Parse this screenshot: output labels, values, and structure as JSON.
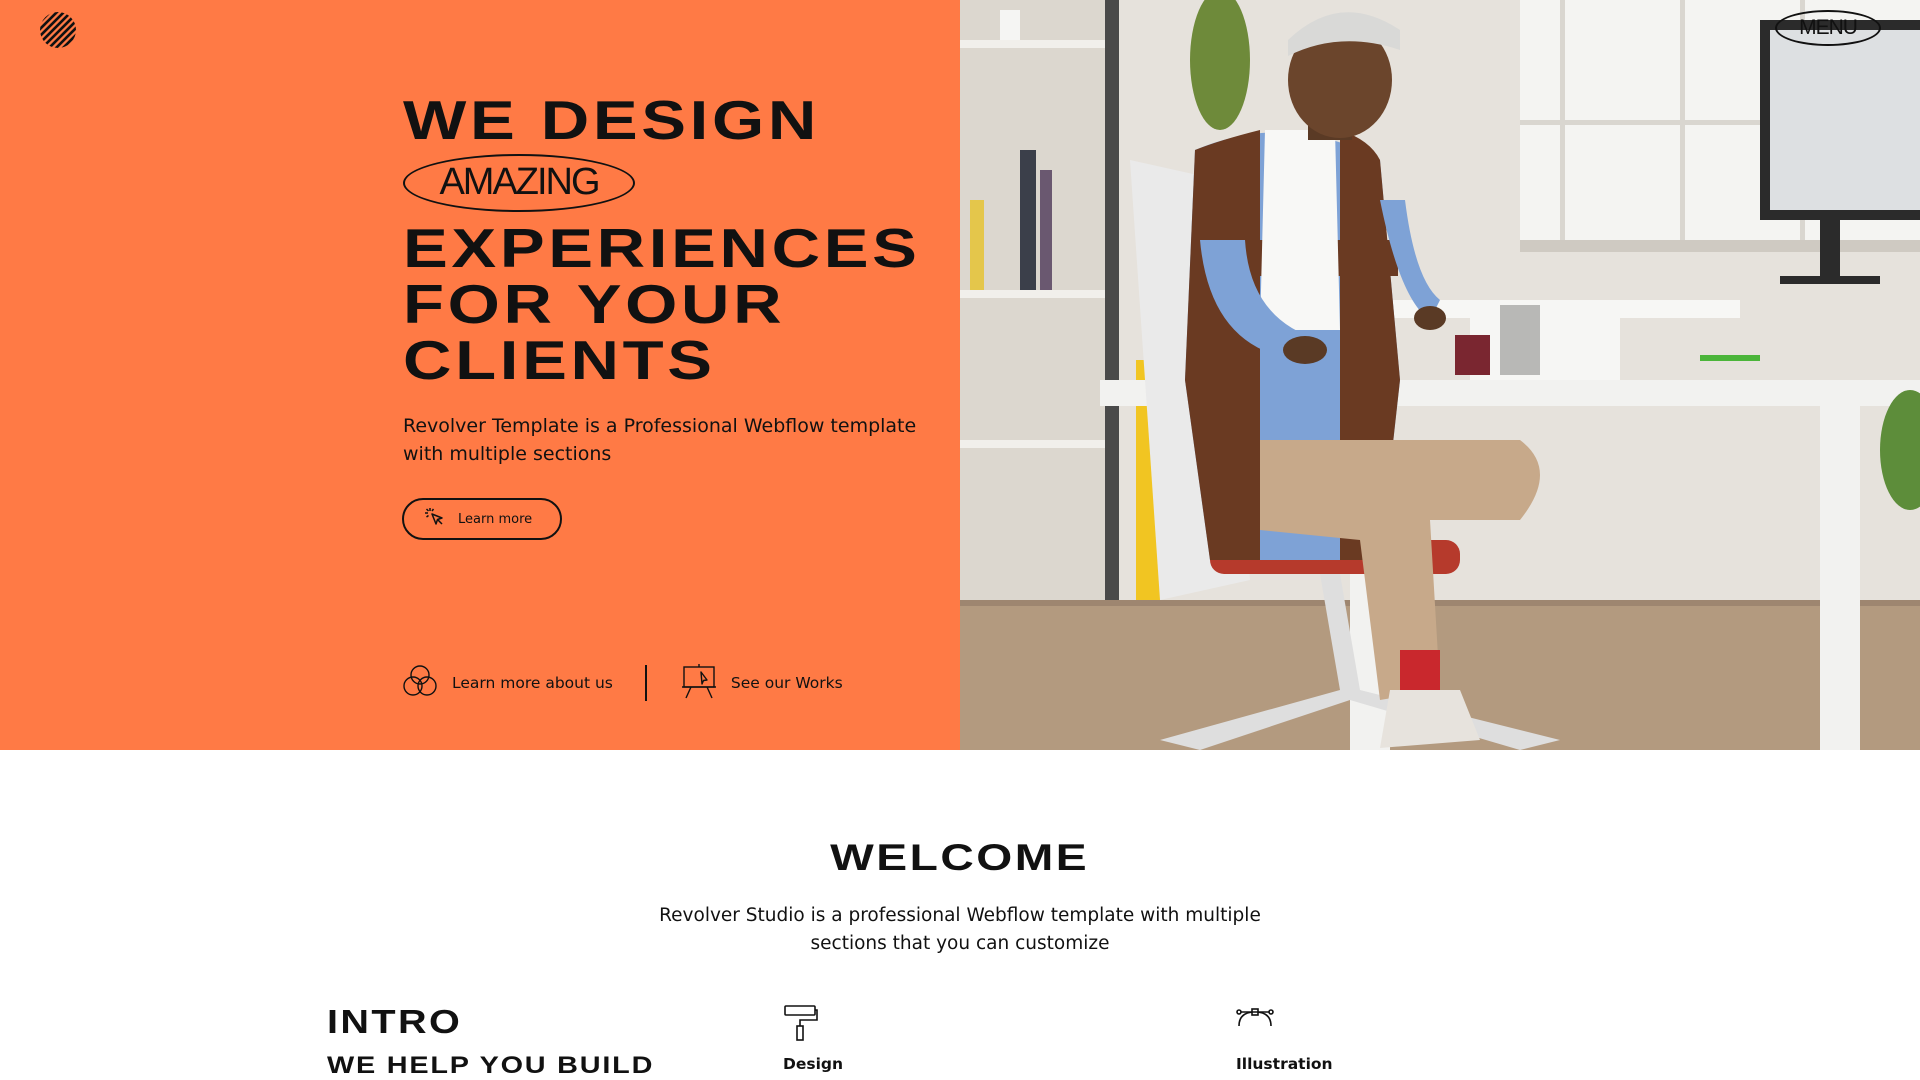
{
  "brand": {
    "logo_icon": "striped-circle-logo-icon"
  },
  "nav": {
    "menu_label": "MENU"
  },
  "hero": {
    "headline_line1": "WE DESIGN",
    "headline_highlight": "AMAZING",
    "headline_line2": "EXPERIENCES",
    "headline_line3": "FOR YOUR",
    "headline_line4": "CLIENTS",
    "subtitle": "Revolver Template is a Professional Webflow template with multiple sections",
    "cta_label": "Learn more",
    "cta_icon": "cursor-click-icon",
    "links": [
      {
        "label": "Learn more about us",
        "icon": "three-circles-icon"
      },
      {
        "label": "See our Works",
        "icon": "presentation-board-icon"
      }
    ],
    "background_color": "#FF7A45",
    "image_alt": "photo-man-at-desk"
  },
  "welcome": {
    "title": "WELCOME",
    "subtitle": "Revolver Studio is a professional Webflow template with multiple sections that you can customize"
  },
  "intro": {
    "title": "INTRO",
    "subtitle": "WE HELP YOU BUILD"
  },
  "services": [
    {
      "label": "Design",
      "icon": "paint-roller-icon"
    },
    {
      "label": "Illustration",
      "icon": "bezier-pen-icon"
    }
  ]
}
